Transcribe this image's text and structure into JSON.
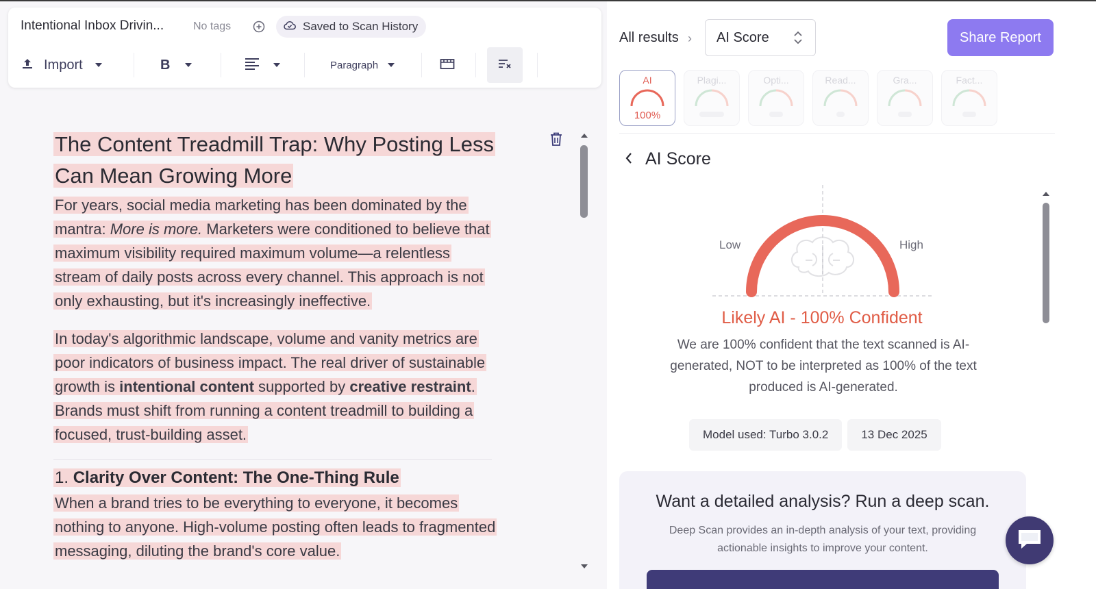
{
  "editor": {
    "doc_title": "Intentional Inbox Drivin...",
    "no_tags": "No tags",
    "saved_label": "Saved to Scan History",
    "toolbar": {
      "import_label": "Import",
      "bold_label": "B",
      "paragraph_label": "Paragraph"
    },
    "document": {
      "title": "The Content Treadmill Trap: Why Posting Less Can Mean Growing More",
      "p1_a": "For years, social media marketing has been dominated by the mantra: ",
      "p1_em": "More is more.",
      "p1_b": " Marketers were conditioned to believe that maximum visibility required maximum volume—a relentless stream of daily posts across every channel. This approach is not only exhausting, but it's increasingly ineffective.",
      "p2_a": "In today's algorithmic landscape, volume and vanity metrics are poor indicators of business impact. The real driver of sustainable growth is ",
      "p2_strong1": "intentional content",
      "p2_b": " supported by ",
      "p2_strong2": "creative restraint",
      "p2_c": ". Brands must shift from running a content treadmill to building a focused, trust-building asset.",
      "h2_num": "1. ",
      "h2_text": "Clarity Over Content: The One-Thing Rule",
      "p3": "When a brand tries to be everything to everyone, it becomes nothing to anyone. High-volume posting often leads to fragmented messaging, diluting the brand's core value."
    }
  },
  "results": {
    "crumb_all": "All results",
    "selected_view": "AI Score",
    "share_label": "Share Report",
    "tabs": [
      {
        "label": "AI",
        "value": "100%",
        "active": true
      },
      {
        "label": "Plagi...",
        "value": "",
        "active": false
      },
      {
        "label": "Opti...",
        "value": "",
        "active": false
      },
      {
        "label": "Read...",
        "value": "",
        "active": false
      },
      {
        "label": "Gra...",
        "value": "",
        "active": false
      },
      {
        "label": "Fact...",
        "value": "",
        "active": false
      }
    ],
    "section_title": "AI Score",
    "gauge": {
      "low_label": "Low",
      "high_label": "High",
      "level": 1.0,
      "color": "#e8685a"
    },
    "verdict": "Likely AI - 100% Confident",
    "explanation": "We are 100% confident that the text scanned is AI-generated, NOT to be interpreted as 100% of the text produced is AI-generated.",
    "model_chip": "Model used: Turbo 3.0.2",
    "date_chip": "13 Dec 2025",
    "deep_scan": {
      "title": "Want a detailed analysis? Run a deep scan.",
      "subtitle": "Deep Scan provides an in-depth analysis of your text, providing actionable insights to improve your content."
    }
  },
  "colors": {
    "accent": "#8d7af0",
    "ai_red": "#e05c46",
    "highlight": "#f6d7d7",
    "dark_purple": "#403a73"
  }
}
